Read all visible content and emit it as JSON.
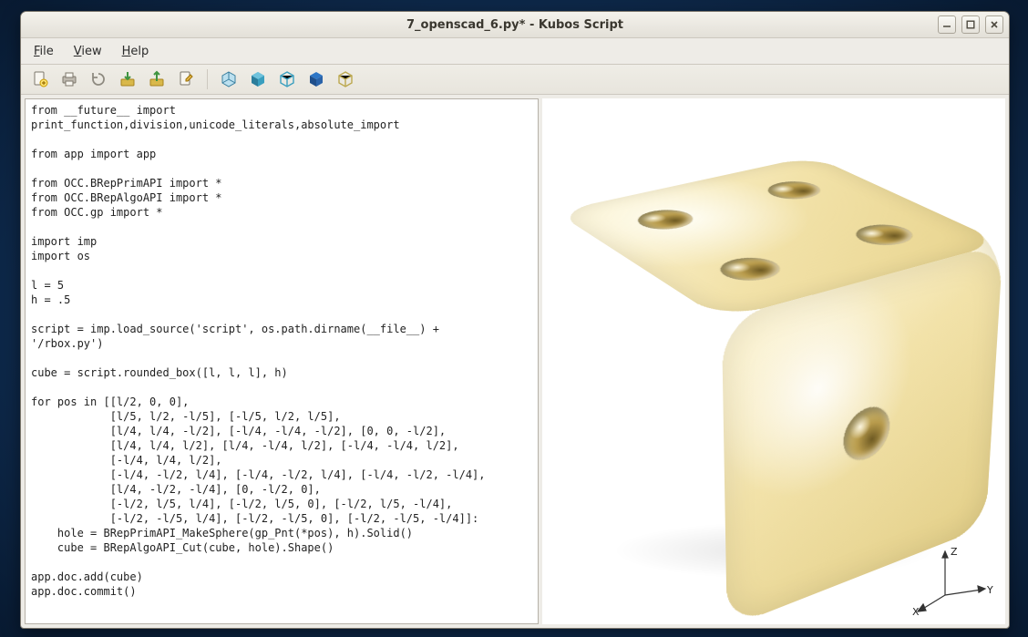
{
  "window": {
    "title": "7_openscad_6.py* - Kubos Script",
    "controls": {
      "minimize_name": "minimize-button",
      "maximize_name": "maximize-button",
      "close_name": "close-button"
    }
  },
  "menubar": {
    "file": "File",
    "view": "View",
    "help": "Help"
  },
  "toolbar": {
    "items": [
      {
        "name": "new-file-button"
      },
      {
        "name": "print-button"
      },
      {
        "name": "refresh-button"
      },
      {
        "name": "import-button"
      },
      {
        "name": "export-button"
      },
      {
        "name": "edit-source-button"
      }
    ],
    "view_items": [
      {
        "name": "view-shaded-button"
      },
      {
        "name": "view-solid-button"
      },
      {
        "name": "view-wireframe-button"
      },
      {
        "name": "view-hiddenline-button"
      },
      {
        "name": "view-bbox-button"
      }
    ]
  },
  "code": "from __future__ import\nprint_function,division,unicode_literals,absolute_import\n\nfrom app import app\n\nfrom OCC.BRepPrimAPI import *\nfrom OCC.BRepAlgoAPI import *\nfrom OCC.gp import *\n\nimport imp\nimport os\n\nl = 5\nh = .5\n\nscript = imp.load_source('script', os.path.dirname(__file__) +\n'/rbox.py')\n\ncube = script.rounded_box([l, l, l], h)\n\nfor pos in [[l/2, 0, 0],\n            [l/5, l/2, -l/5], [-l/5, l/2, l/5],\n            [l/4, l/4, -l/2], [-l/4, -l/4, -l/2], [0, 0, -l/2],\n            [l/4, l/4, l/2], [l/4, -l/4, l/2], [-l/4, -l/4, l/2],\n            [-l/4, l/4, l/2],\n            [-l/4, -l/2, l/4], [-l/4, -l/2, l/4], [-l/4, -l/2, -l/4],\n            [l/4, -l/2, -l/4], [0, -l/2, 0],\n            [-l/2, l/5, l/4], [-l/2, l/5, 0], [-l/2, l/5, -l/4],\n            [-l/2, -l/5, l/4], [-l/2, -l/5, 0], [-l/2, -l/5, -l/4]]:\n    hole = BRepPrimAPI_MakeSphere(gp_Pnt(*pos), h).Solid()\n    cube = BRepAlgoAPI_Cut(cube, hole).Shape()\n\napp.doc.add(cube)\napp.doc.commit()",
  "axes": {
    "x_label": "X",
    "y_label": "Y",
    "z_label": "Z"
  }
}
